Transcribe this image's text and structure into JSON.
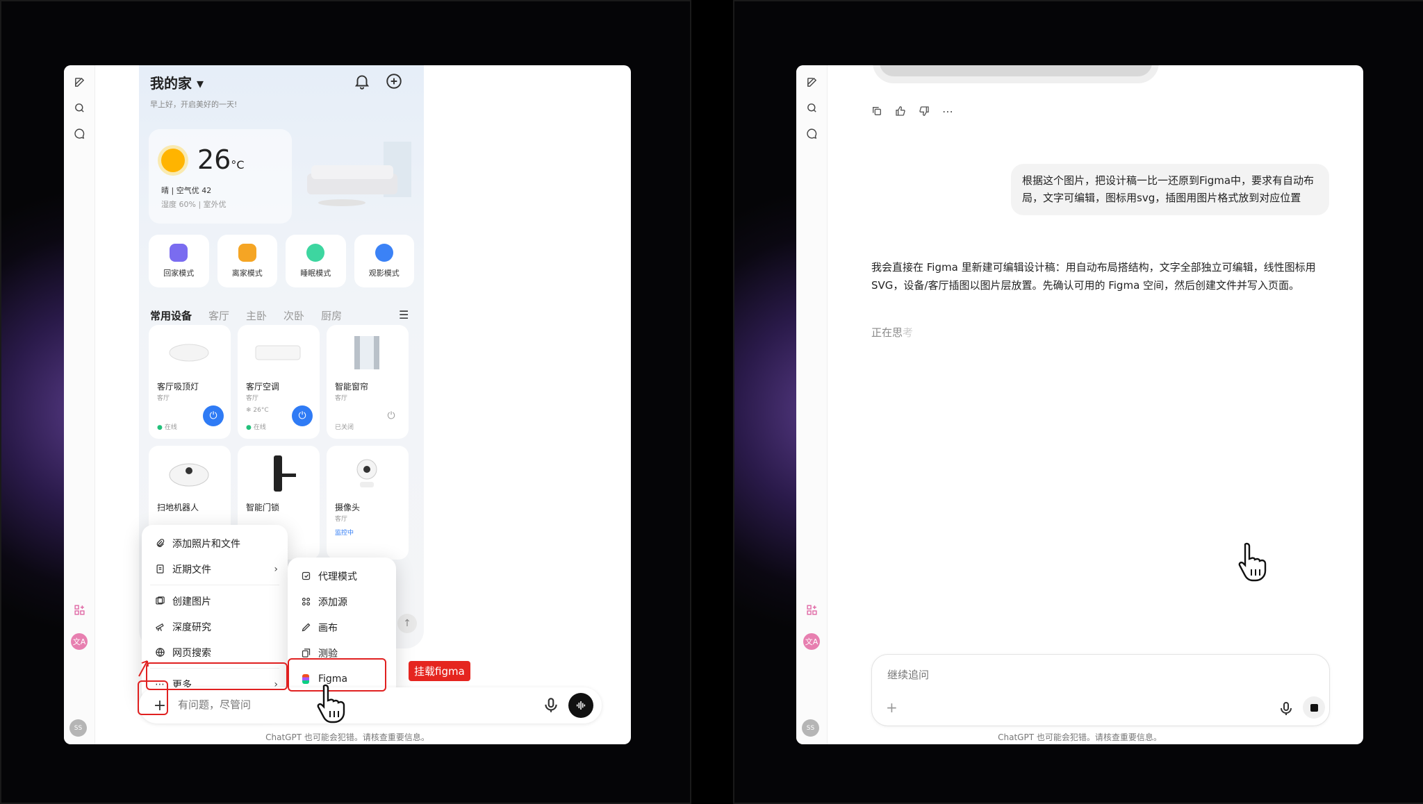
{
  "left": {
    "phone": {
      "title": "我的家 ▾",
      "subtitle": "早上好，开启美好的一天!",
      "weather": {
        "temp": "26",
        "unit": "°C",
        "line1": "晴 | 空气优 42",
        "line2": "湿度 60% | 室外优"
      },
      "modes": [
        "回家模式",
        "离家模式",
        "睡眠模式",
        "观影模式"
      ],
      "mode_colors": [
        "#7a6cf0",
        "#f5a524",
        "#3dd6a0",
        "#3b82f6"
      ],
      "tabs": [
        "常用设备",
        "客厅",
        "主卧",
        "次卧",
        "厨房"
      ],
      "devices": [
        {
          "name": "客厅吸顶灯",
          "room": "客厅",
          "status": "在线",
          "extra": ""
        },
        {
          "name": "客厅空调",
          "room": "客厅",
          "status": "在线",
          "extra": "❄ 26°C"
        },
        {
          "name": "智能窗帘",
          "room": "客厅",
          "status": "已关闭",
          "extra": ""
        },
        {
          "name": "扫地机器人",
          "room": "",
          "status": "",
          "extra": ""
        },
        {
          "name": "智能门锁",
          "room": "",
          "status": "",
          "extra": ""
        },
        {
          "name": "摄像头",
          "room": "客厅",
          "status": "监控中",
          "extra": ""
        }
      ]
    },
    "menu_main": [
      {
        "label": "添加照片和文件",
        "icon": "paperclip-icon"
      },
      {
        "label": "近期文件",
        "icon": "file-icon"
      },
      {
        "label": "创建图片",
        "icon": "image-icon"
      },
      {
        "label": "深度研究",
        "icon": "telescope-icon"
      },
      {
        "label": "网页搜索",
        "icon": "globe-icon"
      },
      {
        "label": "更多",
        "icon": "ellipsis-icon"
      }
    ],
    "menu_sub": [
      {
        "label": "代理模式",
        "icon": "agent-icon"
      },
      {
        "label": "添加源",
        "icon": "apps-icon"
      },
      {
        "label": "画布",
        "icon": "pen-icon"
      },
      {
        "label": "测验",
        "icon": "quiz-icon"
      },
      {
        "label": "Figma",
        "icon": "figma-icon"
      }
    ],
    "callout": "挂载figma",
    "composer_placeholder": "有问题，尽管问",
    "footer": "ChatGPT 也可能会犯错。请核查重要信息。"
  },
  "right": {
    "user_message": "根据这个图片，把设计稿一比一还原到Figma中，要求有自动布局，文字可编辑，图标用svg，插图用图片格式放到对应位置",
    "assistant_message": "我会直接在 Figma 里新建可编辑设计稿：用自动布局搭结构，文字全部独立可编辑，线性图标用 SVG，设备/客厅插图以图片层放置。先确认可用的 Figma 空间，然后创建文件并写入页面。",
    "thinking": {
      "a": "正在思",
      "b": "考"
    },
    "composer_placeholder": "继续追问",
    "footer": "ChatGPT 也可能会犯错。请核查重要信息。"
  },
  "avatar": "SS",
  "colors": {
    "accent": "#2f7bf5",
    "highlight": "#e02020",
    "tag": "#e5251f"
  }
}
